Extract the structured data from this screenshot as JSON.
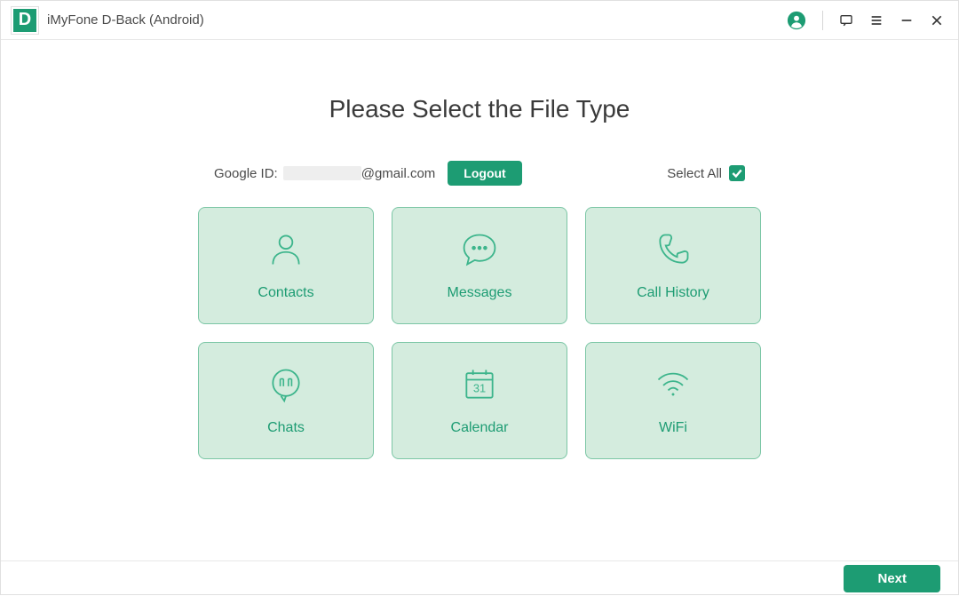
{
  "app": {
    "title": "iMyFone D-Back (Android)",
    "logoLetter": "D"
  },
  "page": {
    "title": "Please Select the File Type"
  },
  "account": {
    "googleIdLabel": "Google ID:",
    "emailSuffix": "@gmail.com",
    "logoutLabel": "Logout"
  },
  "selectAll": {
    "label": "Select All",
    "checked": true
  },
  "cards": [
    {
      "label": "Contacts",
      "icon": "contacts-icon"
    },
    {
      "label": "Messages",
      "icon": "messages-icon"
    },
    {
      "label": "Call History",
      "icon": "callhistory-icon"
    },
    {
      "label": "Chats",
      "icon": "chats-icon"
    },
    {
      "label": "Calendar",
      "icon": "calendar-icon"
    },
    {
      "label": "WiFi",
      "icon": "wifi-icon"
    }
  ],
  "footer": {
    "nextLabel": "Next"
  },
  "colors": {
    "accent": "#1d9c73",
    "cardBg": "#d4ecde",
    "cardBorder": "#7bc6a5"
  }
}
